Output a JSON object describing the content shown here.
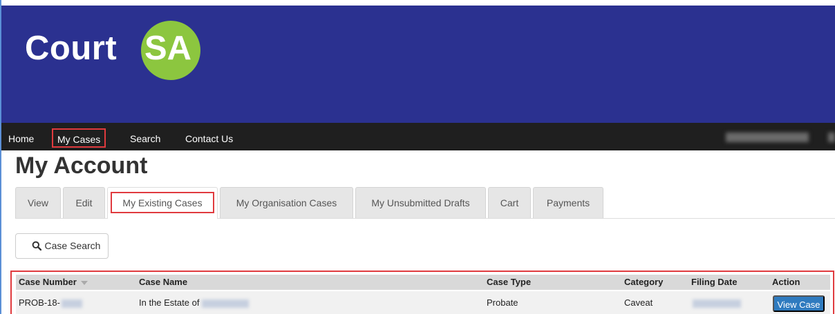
{
  "header": {
    "logo_part1": "Court",
    "logo_part2": "SA",
    "bg_color": "#2b3190",
    "logo_accent": "#8cc63f"
  },
  "nav": {
    "items": [
      {
        "label": "Home"
      },
      {
        "label": "My Cases"
      },
      {
        "label": "Search"
      },
      {
        "label": "Contact Us"
      }
    ]
  },
  "page": {
    "title": "My Account"
  },
  "tabs": [
    {
      "label": "View"
    },
    {
      "label": "Edit"
    },
    {
      "label": "My Existing Cases"
    },
    {
      "label": "My Organisation Cases"
    },
    {
      "label": "My Unsubmitted Drafts"
    },
    {
      "label": "Cart"
    },
    {
      "label": "Payments"
    }
  ],
  "case_search": {
    "label": "Case Search",
    "icon": "search-icon"
  },
  "table": {
    "columns": [
      "Case Number",
      "Case Name",
      "Case Type",
      "Category",
      "Filing Date",
      "Action"
    ],
    "rows": [
      {
        "case_number": "PROB-18-",
        "case_name": "In the Estate of",
        "case_type": "Probate",
        "category": "Caveat",
        "action": "View Case"
      }
    ]
  },
  "colors": {
    "highlight": "#e03a3e",
    "primary_button": "#2f7bbf"
  }
}
